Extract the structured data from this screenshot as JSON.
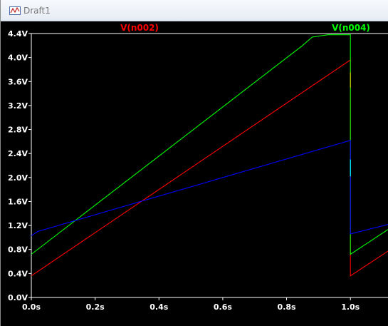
{
  "window": {
    "title": "Draft1",
    "icon": "waveform-icon"
  },
  "colors": {
    "background": "#000000",
    "axis": "#ffffff",
    "n002": "#ff0000",
    "n004": "#00ff00",
    "blue_trace": "#0000ff",
    "cursor_marker": "#00ffff"
  },
  "chart_data": {
    "type": "line",
    "title": "",
    "xlabel": "",
    "ylabel": "",
    "xlim": [
      0.0,
      1.12
    ],
    "ylim": [
      0.0,
      4.4
    ],
    "x_ticks": [
      "0.0s",
      "0.2s",
      "0.4s",
      "0.6s",
      "0.8s",
      "1.0s"
    ],
    "x_tick_values": [
      0.0,
      0.2,
      0.4,
      0.6,
      0.8,
      1.0
    ],
    "y_ticks": [
      "0.0V",
      "0.4V",
      "0.8V",
      "1.2V",
      "1.6V",
      "2.0V",
      "2.4V",
      "2.8V",
      "3.2V",
      "3.6V",
      "4.0V",
      "4.4V"
    ],
    "y_tick_values": [
      0.0,
      0.4,
      0.8,
      1.2,
      1.6,
      2.0,
      2.4,
      2.8,
      3.2,
      3.6,
      4.0,
      4.4
    ],
    "grid": false,
    "series": [
      {
        "name": "V(n002)",
        "color": "#ff0000",
        "x": [
          0.0,
          1.0,
          1.0,
          1.12
        ],
        "y": [
          0.36,
          3.96,
          0.36,
          0.78
        ]
      },
      {
        "name": "V(n004)",
        "color": "#00ff00",
        "x": [
          0.0,
          0.85,
          0.88,
          0.93,
          1.0,
          1.0,
          1.12
        ],
        "y": [
          0.72,
          4.2,
          4.34,
          4.38,
          4.38,
          0.72,
          1.14
        ]
      },
      {
        "color": "#0000ff",
        "x": [
          0.0,
          0.02,
          1.0,
          1.0,
          1.12
        ],
        "y": [
          1.03,
          1.1,
          2.62,
          1.06,
          1.22
        ]
      }
    ]
  }
}
